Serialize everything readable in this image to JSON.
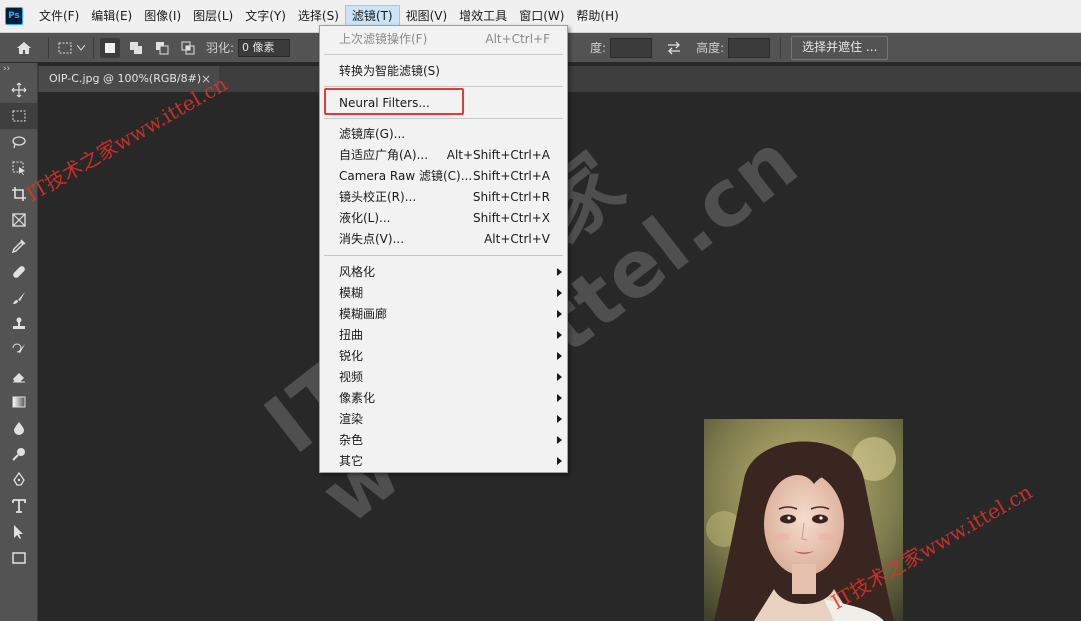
{
  "app": {
    "logo": "Ps"
  },
  "menubar": {
    "items": [
      "文件(F)",
      "编辑(E)",
      "图像(I)",
      "图层(L)",
      "文字(Y)",
      "选择(S)",
      "滤镜(T)",
      "视图(V)",
      "增效工具",
      "窗口(W)",
      "帮助(H)"
    ],
    "active": "滤镜(T)"
  },
  "options": {
    "feather_label": "羽化:",
    "feather_value": "0 像素",
    "height_label": "高度:",
    "width_label_partial": "度:",
    "select_mask_button": "选择并遮住 ..."
  },
  "document_tab": {
    "title": "OIP-C.jpg @ 100%(RGB/8#)",
    "close": "×"
  },
  "filter_menu": {
    "items": [
      {
        "label": "上次滤镜操作(F)",
        "shortcut": "Alt+Ctrl+F",
        "disabled": true
      },
      {
        "label": "转换为智能滤镜(S)",
        "shortcut": ""
      },
      {
        "label": "Neural Filters...",
        "shortcut": "",
        "highlighted": true
      },
      {
        "label": "滤镜库(G)...",
        "shortcut": ""
      },
      {
        "label": "自适应广角(A)...",
        "shortcut": "Alt+Shift+Ctrl+A"
      },
      {
        "label": "Camera Raw 滤镜(C)...",
        "shortcut": "Shift+Ctrl+A"
      },
      {
        "label": "镜头校正(R)...",
        "shortcut": "Shift+Ctrl+R"
      },
      {
        "label": "液化(L)...",
        "shortcut": "Shift+Ctrl+X"
      },
      {
        "label": "消失点(V)...",
        "shortcut": "Alt+Ctrl+V"
      },
      {
        "label": "风格化",
        "submenu": true
      },
      {
        "label": "模糊",
        "submenu": true
      },
      {
        "label": "模糊画廊",
        "submenu": true
      },
      {
        "label": "扭曲",
        "submenu": true
      },
      {
        "label": "锐化",
        "submenu": true
      },
      {
        "label": "视频",
        "submenu": true
      },
      {
        "label": "像素化",
        "submenu": true
      },
      {
        "label": "渲染",
        "submenu": true
      },
      {
        "label": "杂色",
        "submenu": true
      },
      {
        "label": "其它",
        "submenu": true
      }
    ]
  },
  "toolbar_tools": [
    "move-tool",
    "rectangular-marquee-tool",
    "lasso-tool",
    "object-selection-tool",
    "crop-tool",
    "frame-tool",
    "eyedropper-tool",
    "healing-brush-tool",
    "brush-tool",
    "clone-stamp-tool",
    "history-brush-tool",
    "eraser-tool",
    "gradient-tool",
    "blur-tool",
    "dodge-tool",
    "pen-tool",
    "type-tool",
    "path-selection-tool",
    "rectangle-tool"
  ],
  "watermarks": {
    "big_line1": "IT技术之家",
    "big_line2": "www.ittel.cn",
    "red_top": "IT技术之家www.ittel.cn",
    "red_bottom": "IT技术之家www.ittel.cn"
  },
  "colors": {
    "highlight": "#e03b3b",
    "menubar_bg": "#f0f0f0",
    "panel_bg": "#535353",
    "canvas_bg": "#282828"
  }
}
